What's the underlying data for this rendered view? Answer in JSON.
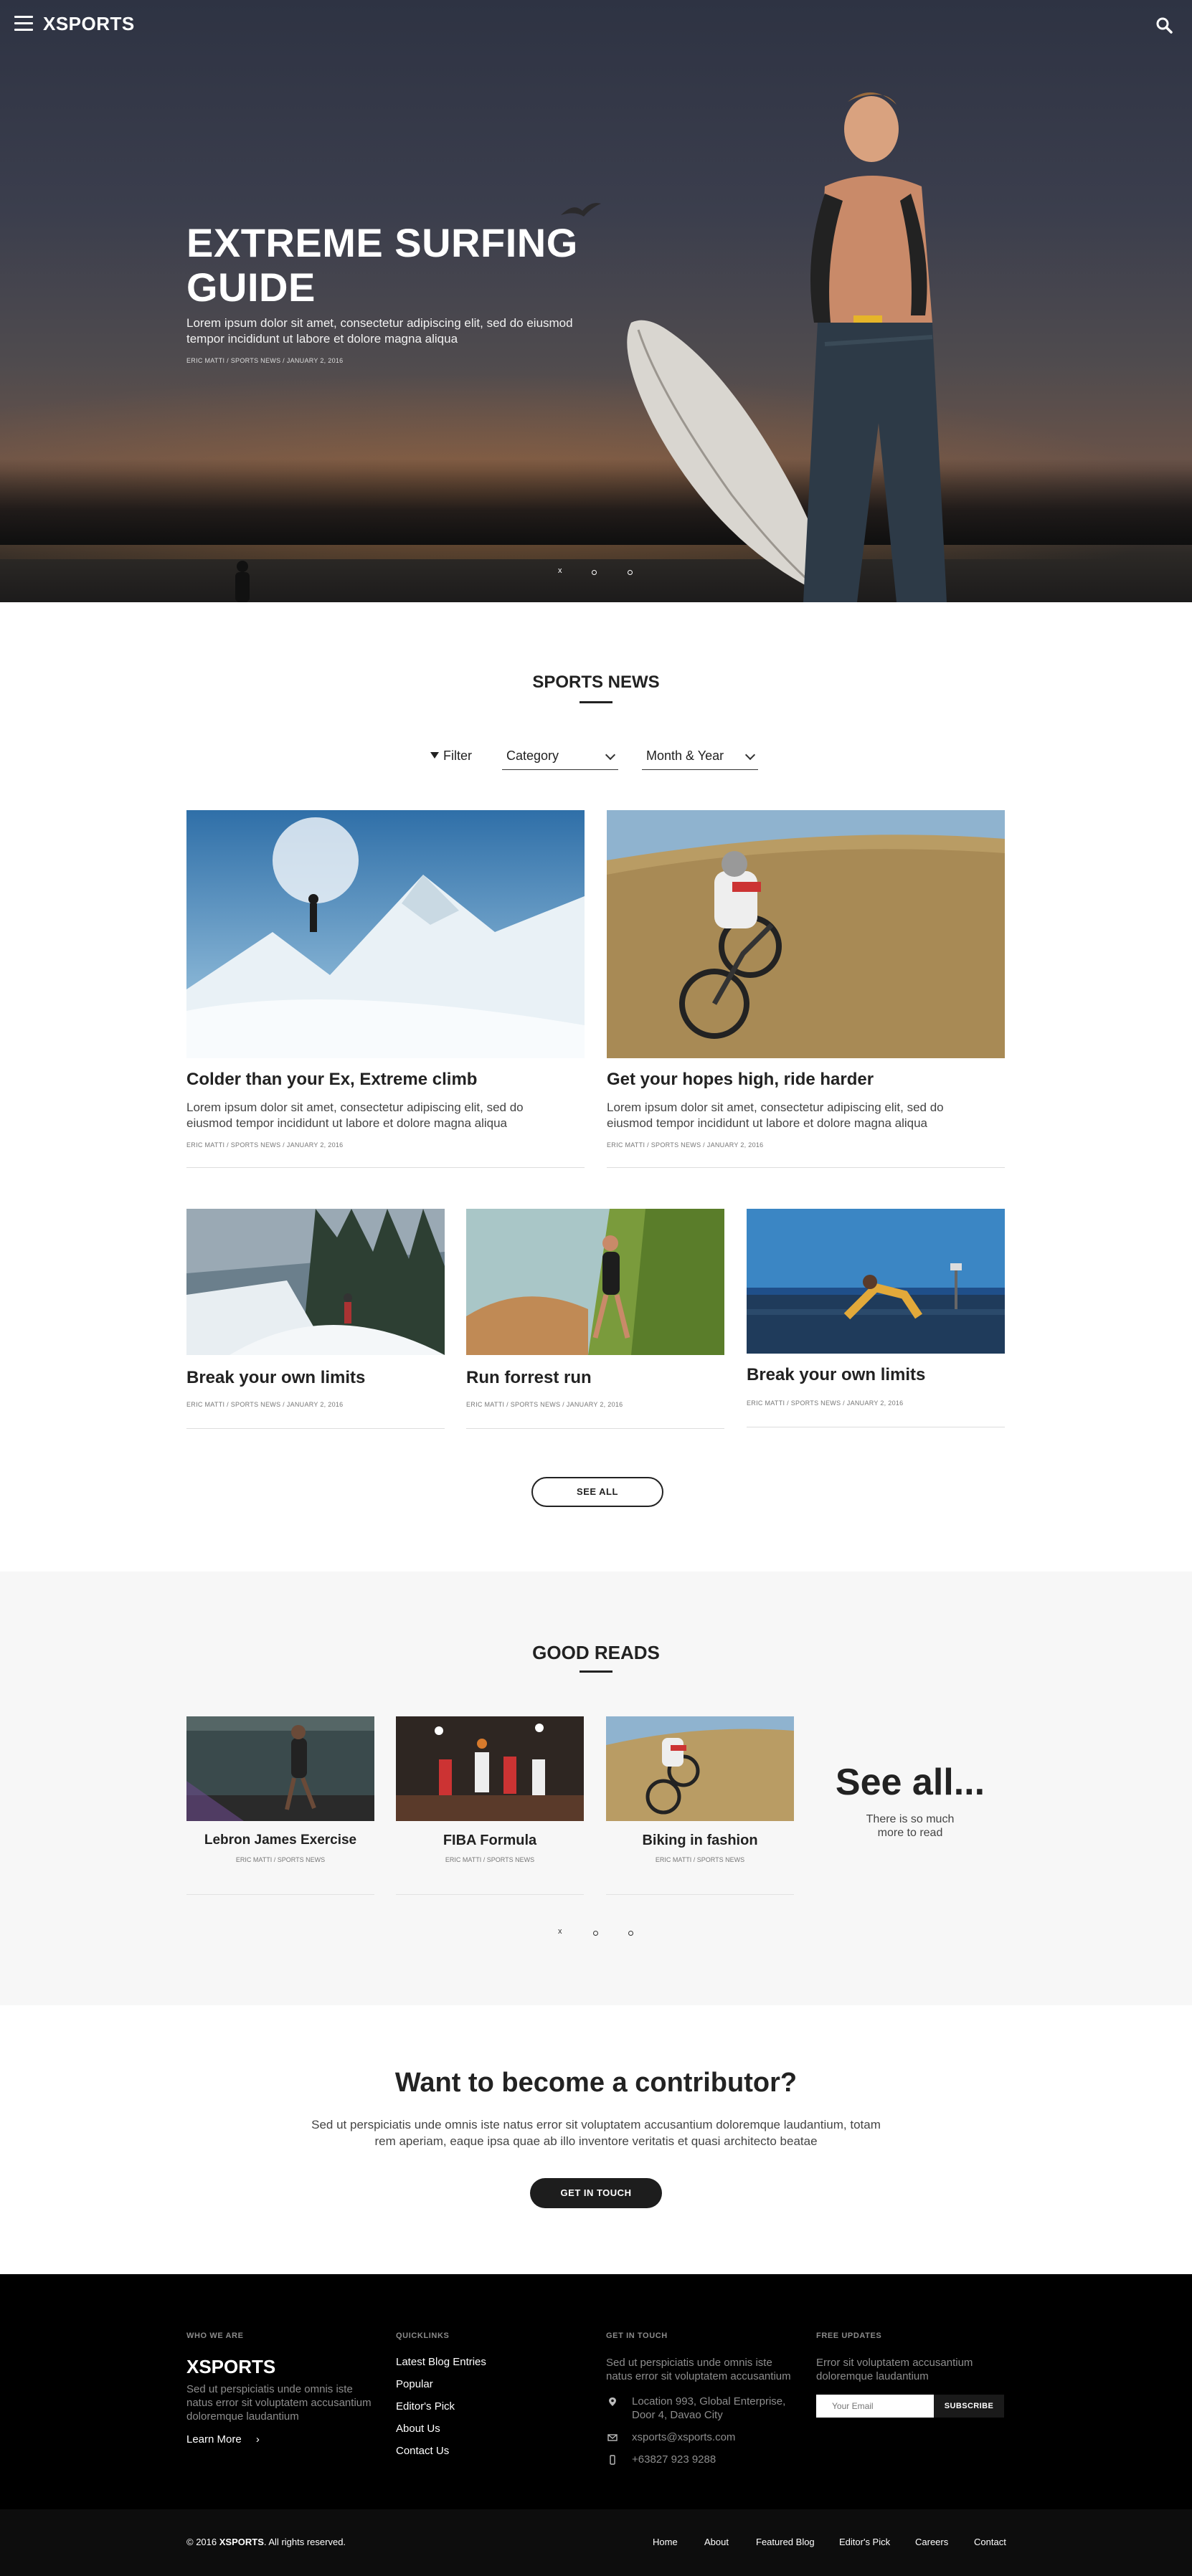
{
  "header": {
    "logo": "XSPORTS"
  },
  "hero": {
    "title": "EXTREME SURFING GUIDE",
    "description": "Lorem ipsum dolor sit amet, consectetur adipiscing elit, sed do eiusmod tempor incididunt ut labore et dolore magna aliqua",
    "meta": "ERIC MATTI / SPORTS NEWS / JANUARY 2, 2016",
    "dots": {
      "close": "x"
    }
  },
  "sports_news": {
    "title": "SPORTS NEWS",
    "filter_label": "Filter",
    "category_select": "Category",
    "month_select": "Month & Year",
    "cards": [
      {
        "title": "Colder than your Ex, Extreme climb",
        "description": "Lorem ipsum dolor sit amet, consectetur adipiscing elit, sed do eiusmod tempor incididunt ut labore et dolore magna aliqua",
        "meta": "ERIC MATTI / SPORTS NEWS / JANUARY 2, 2016"
      },
      {
        "title": "Get your hopes high, ride harder",
        "description": "Lorem ipsum dolor sit amet, consectetur adipiscing elit, sed do eiusmod tempor incididunt ut labore et dolore magna aliqua",
        "meta": "ERIC MATTI / SPORTS NEWS / JANUARY 2, 2016"
      },
      {
        "title": "Break your own limits",
        "meta": "ERIC MATTI / SPORTS NEWS / JANUARY 2, 2016"
      },
      {
        "title": "Run forrest run",
        "meta": "ERIC MATTI / SPORTS NEWS / JANUARY 2, 2016"
      },
      {
        "title": "Break your own limits",
        "meta": "ERIC MATTI / SPORTS NEWS / JANUARY 2, 2016"
      }
    ],
    "see_all": "SEE ALL"
  },
  "good_reads": {
    "title": "GOOD READS",
    "cards": [
      {
        "title": "Lebron James Exercise",
        "meta": "ERIC MATTI / SPORTS NEWS"
      },
      {
        "title": "FIBA Formula",
        "meta": "ERIC MATTI / SPORTS NEWS"
      },
      {
        "title": "Biking in fashion",
        "meta": "ERIC MATTI / SPORTS NEWS"
      }
    ],
    "see_all_big": "See all...",
    "see_all_sub": "There is so much more to read",
    "dots": {
      "close": "x"
    }
  },
  "contributor": {
    "title": "Want to become a contributor?",
    "description": "Sed ut perspiciatis unde omnis iste natus error sit voluptatem accusantium doloremque laudantium, totam rem aperiam, eaque ipsa quae ab illo inventore veritatis et quasi architecto beatae",
    "button": "GET IN TOUCH"
  },
  "footer": {
    "who_we_are": {
      "heading": "WHO WE ARE",
      "logo": "XSPORTS",
      "text": "Sed ut perspiciatis unde omnis iste natus error sit voluptatem accusantium doloremque laudantium",
      "learn_more": "Learn More"
    },
    "quicklinks": {
      "heading": "QUICKLINKS",
      "links": [
        "Latest Blog Entries",
        "Popular",
        "Editor's Pick",
        "About Us",
        "Contact Us"
      ]
    },
    "get_in_touch": {
      "heading": "GET IN TOUCH",
      "text": "Sed ut perspiciatis unde omnis iste natus error sit voluptatem accusantium",
      "address": "Location 993, Global Enterprise, Door 4, Davao City",
      "email": "xsports@xsports.com",
      "phone": "+63827 923 9288"
    },
    "free_updates": {
      "heading": "FREE UPDATES",
      "text": "Error sit voluptatem accusantium doloremque laudantium",
      "email_placeholder": "Your Email",
      "subscribe": "SUBSCRIBE"
    },
    "bottom": {
      "copyright_prefix": "© 2016",
      "copyright_brand": "XSPORTS",
      "copyright_suffix": ". All rights reserved.",
      "nav": [
        "Home",
        "About",
        "Featured Blog",
        "Editor's Pick",
        "Careers",
        "Contact"
      ]
    }
  },
  "colors": {
    "dark": "#222222",
    "footer_bg": "#000000",
    "reads_bg": "#f7f7f7"
  },
  "icons": {
    "menu": "hamburger-icon",
    "search": "search-icon",
    "filter": "funnel-icon",
    "location": "location-icon",
    "email": "envelope-icon",
    "phone": "phone-icon"
  }
}
